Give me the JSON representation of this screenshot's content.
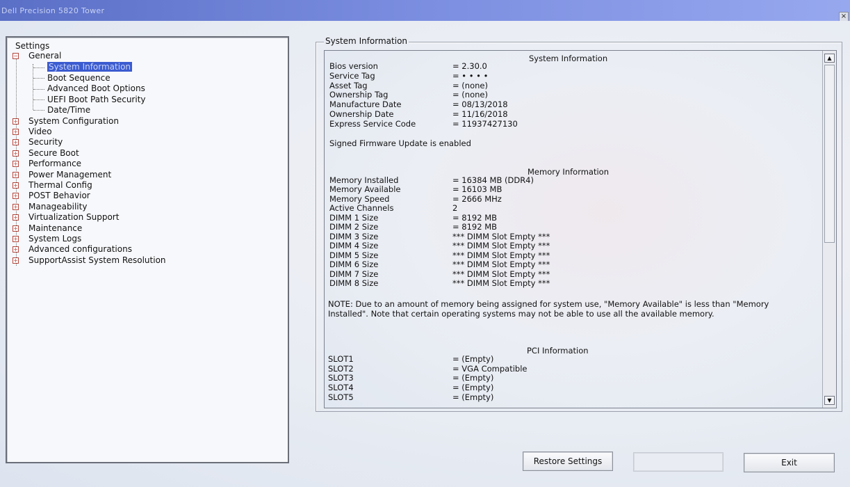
{
  "window": {
    "title": "Dell Precision 5820 Tower",
    "close_glyph": "×"
  },
  "tree": {
    "root": "Settings",
    "general": {
      "label": "General",
      "expander": "−",
      "children": [
        "System Information",
        "Boot Sequence",
        "Advanced Boot Options",
        "UEFI Boot Path Security",
        "Date/Time"
      ]
    },
    "groups": [
      "System Configuration",
      "Video",
      "Security",
      "Secure Boot",
      "Performance",
      "Power Management",
      "Thermal Config",
      "POST Behavior",
      "Manageability",
      "Virtualization Support",
      "Maintenance",
      "System Logs",
      "Advanced configurations",
      "SupportAssist System Resolution"
    ],
    "collapsed_expander": "+"
  },
  "panel": {
    "legend": "System Information",
    "system_heading": "System Information",
    "system_rows": [
      {
        "label": "Bios version",
        "value": "= 2.30.0"
      },
      {
        "label": "Service Tag",
        "value": "= • • • •"
      },
      {
        "label": "Asset Tag",
        "value": "= (none)"
      },
      {
        "label": "Ownership Tag",
        "value": "= (none)"
      },
      {
        "label": "Manufacture Date",
        "value": "= 08/13/2018"
      },
      {
        "label": "Ownership Date",
        "value": "= 11/16/2018"
      },
      {
        "label": "Express Service Code",
        "value": "= 11937427130"
      }
    ],
    "firmware_line": "Signed Firmware Update is enabled",
    "memory_heading": "Memory Information",
    "memory_rows": [
      {
        "label": "Memory Installed",
        "value": "= 16384 MB (DDR4)"
      },
      {
        "label": "Memory Available",
        "value": "= 16103 MB"
      },
      {
        "label": "Memory Speed",
        "value": "= 2666 MHz"
      },
      {
        "label": "Active Channels",
        "value": "2"
      },
      {
        "label": "DIMM 1 Size",
        "value": "= 8192 MB"
      },
      {
        "label": "DIMM 2 Size",
        "value": "= 8192 MB"
      },
      {
        "label": "DIMM 3 Size",
        "value": "*** DIMM Slot Empty ***"
      },
      {
        "label": "DIMM 4 Size",
        "value": "*** DIMM Slot Empty ***"
      },
      {
        "label": "DIMM 5 Size",
        "value": "*** DIMM Slot Empty ***"
      },
      {
        "label": "DIMM 6 Size",
        "value": "*** DIMM Slot Empty ***"
      },
      {
        "label": "DIMM 7 Size",
        "value": "*** DIMM Slot Empty ***"
      },
      {
        "label": "DIMM 8 Size",
        "value": "*** DIMM Slot Empty ***"
      }
    ],
    "note": "NOTE: Due to an amount of memory being assigned for system use, \"Memory Available\" is less than \"Memory Installed\". Note that certain operating systems may not be able to use all the available memory.",
    "pci_heading": "PCI Information",
    "pci_rows": [
      {
        "label": "SLOT1",
        "value": "= (Empty)"
      },
      {
        "label": "SLOT2",
        "value": "= VGA Compatible"
      },
      {
        "label": "SLOT3",
        "value": "= (Empty)"
      },
      {
        "label": "SLOT4",
        "value": "= (Empty)"
      },
      {
        "label": "SLOT5",
        "value": "= (Empty)"
      }
    ],
    "scroll_up": "▲",
    "scroll_down": "▼"
  },
  "buttons": {
    "restore": "Restore Settings",
    "apply": "",
    "exit": "Exit"
  }
}
